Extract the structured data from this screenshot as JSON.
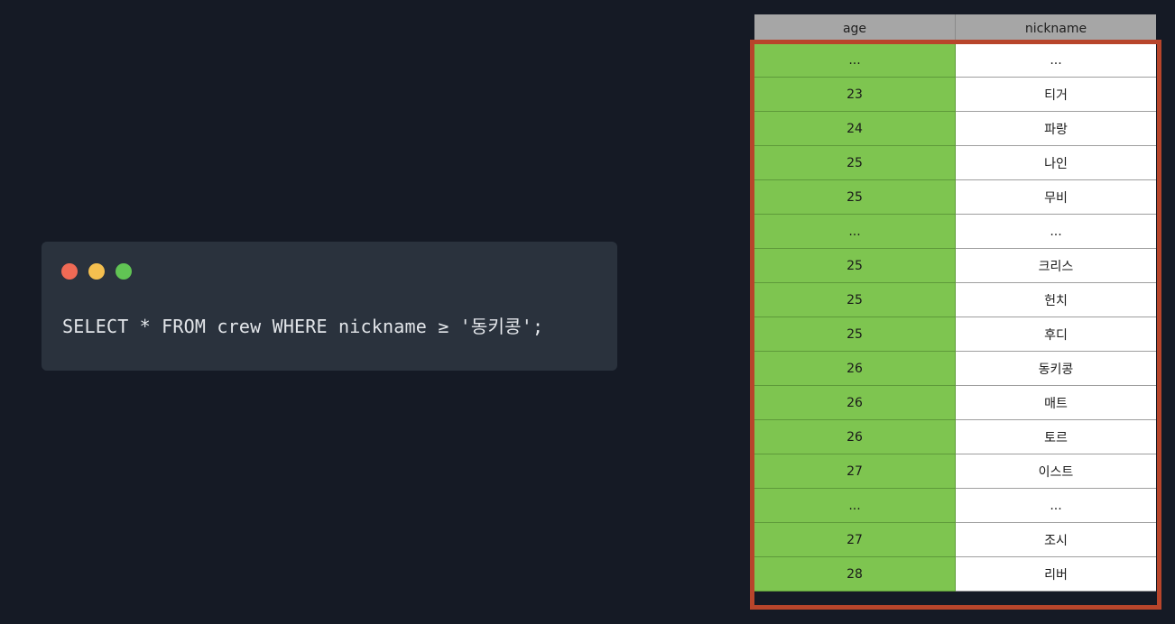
{
  "window_dots": {
    "close_color": "#ef6a55",
    "minimize_color": "#f4bf4f",
    "maximize_color": "#61c454"
  },
  "code": {
    "query": "SELECT * FROM crew WHERE nickname ≥ '동키콩';"
  },
  "table": {
    "headers": [
      "age",
      "nickname"
    ],
    "rows": [
      [
        "...",
        "..."
      ],
      [
        "23",
        "티거"
      ],
      [
        "24",
        "파랑"
      ],
      [
        "25",
        "나인"
      ],
      [
        "25",
        "무비"
      ],
      [
        "...",
        "..."
      ],
      [
        "25",
        "크리스"
      ],
      [
        "25",
        "헌치"
      ],
      [
        "25",
        "후디"
      ],
      [
        "26",
        "동키콩"
      ],
      [
        "26",
        "매트"
      ],
      [
        "26",
        "토르"
      ],
      [
        "27",
        "이스트"
      ],
      [
        "...",
        "..."
      ],
      [
        "27",
        "조시"
      ],
      [
        "28",
        "리버"
      ]
    ]
  },
  "colors": {
    "background": "#151a25",
    "age_column_highlight": "#7ec550",
    "selection_frame": "#b8452b"
  }
}
